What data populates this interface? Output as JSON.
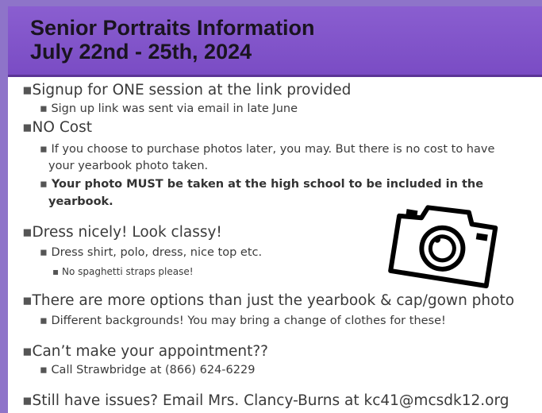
{
  "header": {
    "title_line1": "Senior Portraits Information",
    "title_line2": "July 22nd - 25th, 2024"
  },
  "items": {
    "signup": "Signup for ONE session at the link provided",
    "signup_sub": "Sign up link was sent via email in late June",
    "cost": "NO Cost",
    "cost_sub_1": "If you choose to purchase photos later, you may. But there is no cost to have",
    "cost_sub_2": "your yearbook photo taken.",
    "cost_bold_1": "Your photo MUST be taken at the high school to be included in the",
    "cost_bold_2": "yearbook.",
    "dress": "Dress nicely! Look classy!",
    "dress_sub": "Dress shirt, polo, dress, nice top etc.",
    "dress_sub_sub": "No spaghetti straps please!",
    "options": "There are more options than just the yearbook & cap/gown photo",
    "options_sub": "Different backgrounds! You may bring a change of clothes for these!",
    "appointment": "Can’t make your appointment??",
    "appointment_sub": "Call Strawbridge at (866) 624-6229",
    "issues": "Still have issues? Email Mrs. Clancy-Burns at kc41@mcsdk12.org"
  },
  "bullet": "▪",
  "icons": {
    "camera": "camera-icon"
  },
  "colors": {
    "header": "#7a4cc4",
    "frame": "#8e74c9"
  }
}
